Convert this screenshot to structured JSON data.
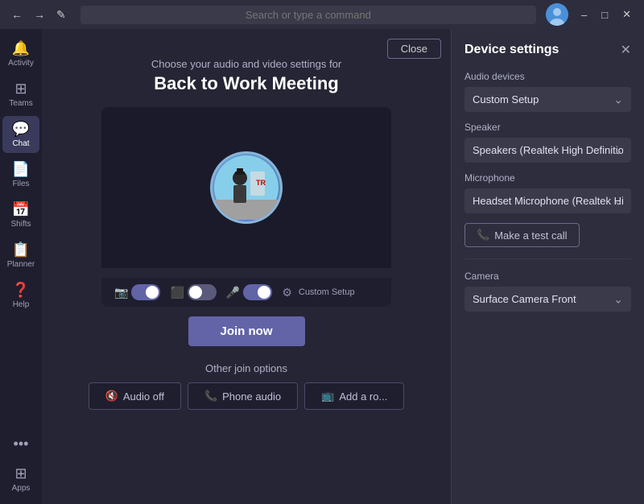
{
  "titlebar": {
    "back_label": "←",
    "forward_label": "→",
    "edit_label": "✎",
    "search_placeholder": "Search or type a command",
    "minimize_label": "–",
    "maximize_label": "□",
    "close_label": "✕"
  },
  "sidebar": {
    "items": [
      {
        "id": "activity",
        "icon": "🔔",
        "label": "Activity"
      },
      {
        "id": "teams",
        "icon": "⊞",
        "label": "Teams"
      },
      {
        "id": "chat",
        "icon": "💬",
        "label": "Chat"
      },
      {
        "id": "files",
        "icon": "📄",
        "label": "Files"
      },
      {
        "id": "shifts",
        "icon": "📅",
        "label": "Shifts"
      },
      {
        "id": "planner",
        "icon": "📋",
        "label": "Planner"
      },
      {
        "id": "help",
        "icon": "❓",
        "label": "Help"
      }
    ],
    "more_label": "...",
    "apps_label": "Apps",
    "help_label": "Help"
  },
  "meeting": {
    "close_label": "Close",
    "subtitle": "Choose your audio and video settings for",
    "title": "Back to Work Meeting",
    "join_label": "Join now",
    "other_join_label": "Other join options",
    "audio_off_label": "Audio off",
    "phone_audio_label": "Phone audio",
    "add_room_label": "Add a ro..."
  },
  "controls": {
    "custom_setup_label": "Custom Setup"
  },
  "device_settings": {
    "title": "Device settings",
    "close_label": "✕",
    "audio_devices_label": "Audio devices",
    "audio_device_value": "Custom Setup",
    "speaker_label": "Speaker",
    "speaker_value": "Speakers (Realtek High Definition Au...",
    "microphone_label": "Microphone",
    "microphone_value": "Headset Microphone (Realtek High D...",
    "test_call_label": "Make a test call",
    "camera_label": "Camera",
    "camera_value": "Surface Camera Front"
  }
}
